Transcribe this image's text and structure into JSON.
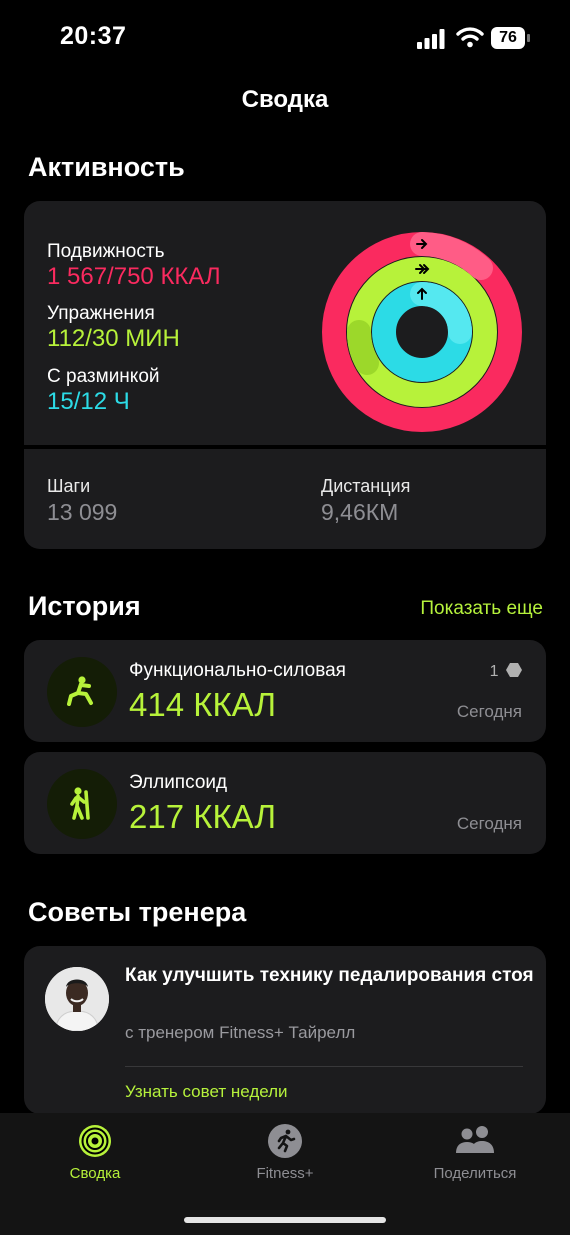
{
  "status_bar": {
    "time": "20:37",
    "battery": "76"
  },
  "nav": {
    "title": "Сводка"
  },
  "activity": {
    "title": "Активность",
    "move": {
      "label": "Подвижность",
      "value": "1 567/750 ККАЛ",
      "progress": 2.09
    },
    "exercise": {
      "label": "Упражнения",
      "value": "112/30 МИН",
      "progress": 3.73
    },
    "stand": {
      "label": "С разминкой",
      "value": "15/12 Ч",
      "progress": 1.25
    },
    "steps": {
      "label": "Шаги",
      "value": "13 099"
    },
    "distance": {
      "label": "Дистанция",
      "value": "9,46КМ"
    }
  },
  "history": {
    "title": "История",
    "show_more": "Показать еще",
    "items": [
      {
        "name": "Функционально-силовая",
        "kcal": "414 ККАЛ",
        "count": "1",
        "date": "Сегодня",
        "icon": "strength-icon"
      },
      {
        "name": "Эллипсоид",
        "kcal": "217 ККАЛ",
        "date": "Сегодня",
        "icon": "elliptical-icon"
      }
    ]
  },
  "coach": {
    "title": "Советы тренера",
    "tip_title": "Как улучшить технику педалирования стоя",
    "tip_sub": "с тренером Fitness+ Тайрелл",
    "link": "Узнать совет недели"
  },
  "tabs": [
    {
      "label": "Сводка",
      "active": true,
      "icon": "summary-rings-icon"
    },
    {
      "label": "Fitness+",
      "active": false,
      "icon": "fitness-runner-icon"
    },
    {
      "label": "Поделиться",
      "active": false,
      "icon": "sharing-people-icon"
    }
  ],
  "colors": {
    "move": "#fa2a5f",
    "exercise": "#b7f23a",
    "stand": "#2cdbe6",
    "accent": "#b6f23c"
  }
}
